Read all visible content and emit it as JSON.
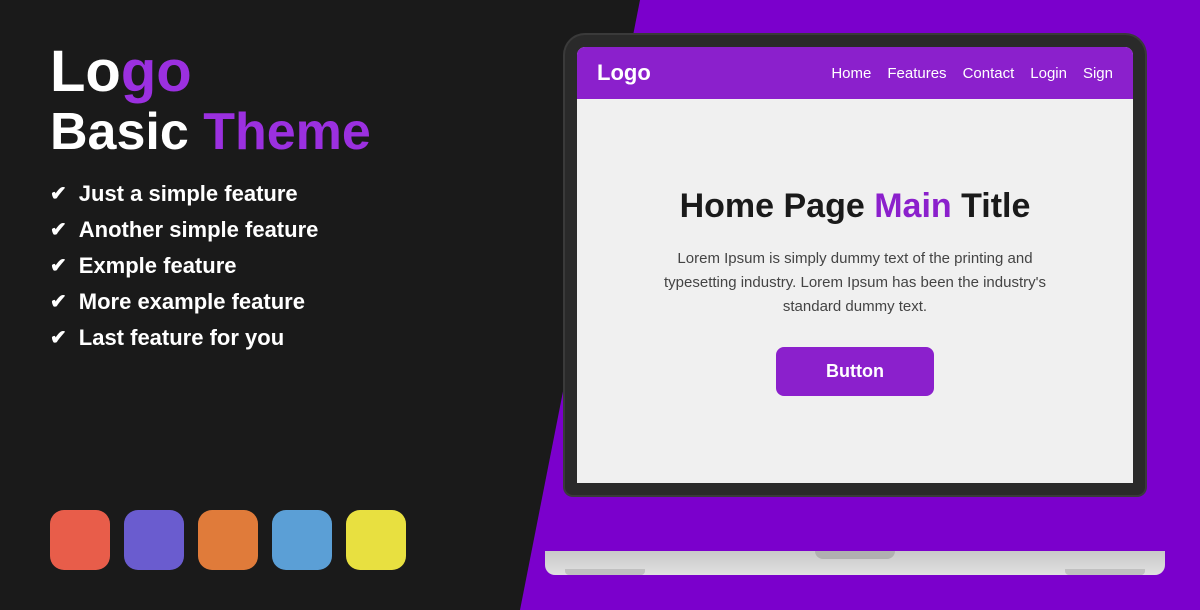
{
  "background": {
    "shape_color": "#7b00cc"
  },
  "left": {
    "logo": {
      "text_white": "Lo",
      "text_purple": "go",
      "tagline_white": "Basic ",
      "tagline_purple": "Theme"
    },
    "features": [
      "Just a simple feature",
      "Another simple feature",
      "Exmple feature",
      "More example feature",
      "Last feature for you"
    ],
    "swatches": [
      {
        "color": "#e85d4a",
        "name": "red-swatch"
      },
      {
        "color": "#6a5ccf",
        "name": "purple-swatch"
      },
      {
        "color": "#e07b3a",
        "name": "orange-swatch"
      },
      {
        "color": "#5b9fd6",
        "name": "blue-swatch"
      },
      {
        "color": "#e8e040",
        "name": "yellow-swatch"
      }
    ]
  },
  "laptop": {
    "nav": {
      "logo": "Logo",
      "links": [
        "Home",
        "Features",
        "Contact",
        "Login",
        "Sign"
      ]
    },
    "screen": {
      "title_black": "Home Page ",
      "title_purple": "Main",
      "title_black2": " Title",
      "body": "Lorem Ipsum is simply dummy text of the printing and typesetting industry. Lorem Ipsum has been the industry's standard dummy text.",
      "button_label": "Button"
    }
  }
}
